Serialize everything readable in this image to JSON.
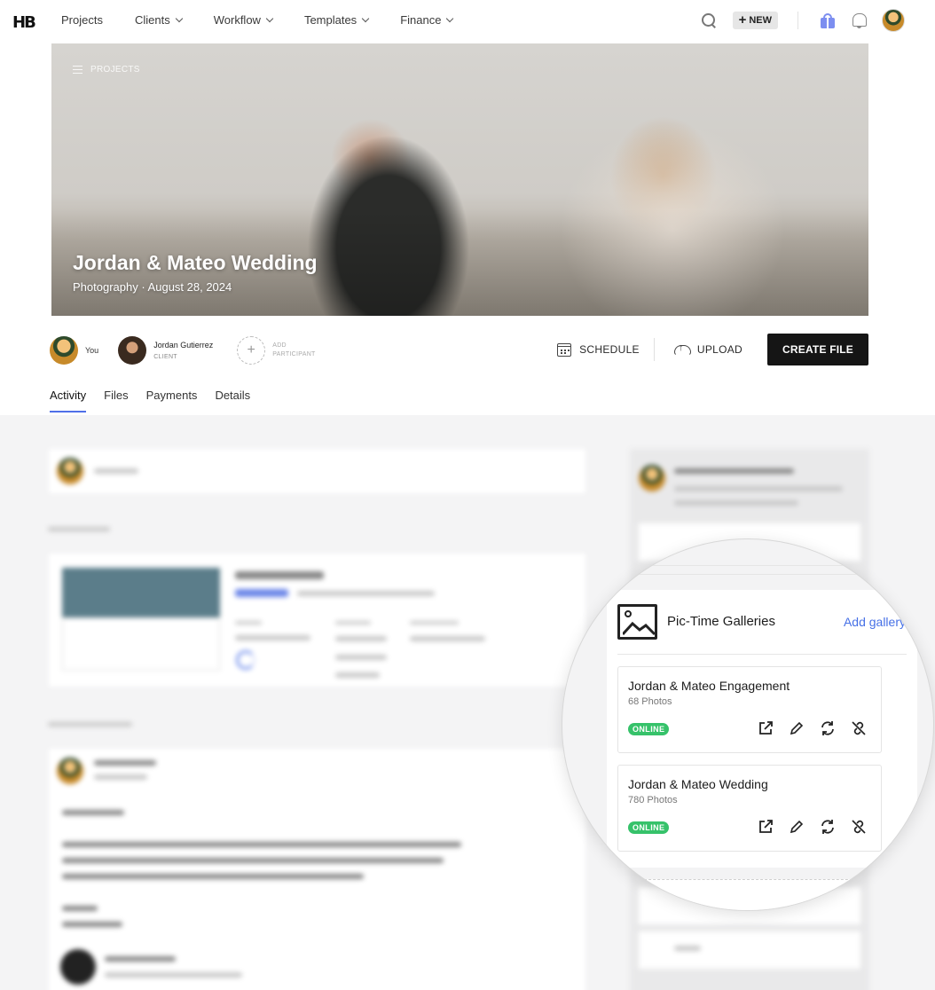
{
  "nav": {
    "logo": "HB",
    "items": [
      {
        "label": "Projects",
        "has_dropdown": false
      },
      {
        "label": "Clients",
        "has_dropdown": true
      },
      {
        "label": "Workflow",
        "has_dropdown": true
      },
      {
        "label": "Templates",
        "has_dropdown": true
      },
      {
        "label": "Finance",
        "has_dropdown": true
      }
    ],
    "new_label": "NEW",
    "icons": [
      "search-icon",
      "gift-icon",
      "bell-icon",
      "avatar"
    ]
  },
  "hero": {
    "breadcrumb": "PROJECTS",
    "title": "Jordan & Mateo Wedding",
    "subtitle": "Photography · August 28, 2024"
  },
  "participants": {
    "you_label": "You",
    "client_name": "Jordan Gutierrez",
    "client_role": "CLIENT",
    "add_label": "ADD PARTICIPANT"
  },
  "actions": {
    "schedule": "SCHEDULE",
    "upload": "UPLOAD",
    "create_file": "CREATE FILE"
  },
  "tabs": [
    {
      "label": "Activity",
      "active": true
    },
    {
      "label": "Files",
      "active": false
    },
    {
      "label": "Payments",
      "active": false
    },
    {
      "label": "Details",
      "active": false
    }
  ],
  "gallery_panel": {
    "title": "Pic-Time Galleries",
    "add_label": "Add gallery",
    "galleries": [
      {
        "name": "Jordan & Mateo Engagement",
        "count": "68 Photos",
        "status": "ONLINE"
      },
      {
        "name": "Jordan & Mateo Wedding",
        "count": "780 Photos",
        "status": "ONLINE"
      }
    ],
    "card_icons": [
      "external-link-icon",
      "pencil-icon",
      "sync-icon",
      "unlink-icon"
    ]
  },
  "colors": {
    "accent": "#4f6fe8",
    "link": "#4670e6",
    "online": "#36c26a",
    "primary_button": "#151515"
  }
}
